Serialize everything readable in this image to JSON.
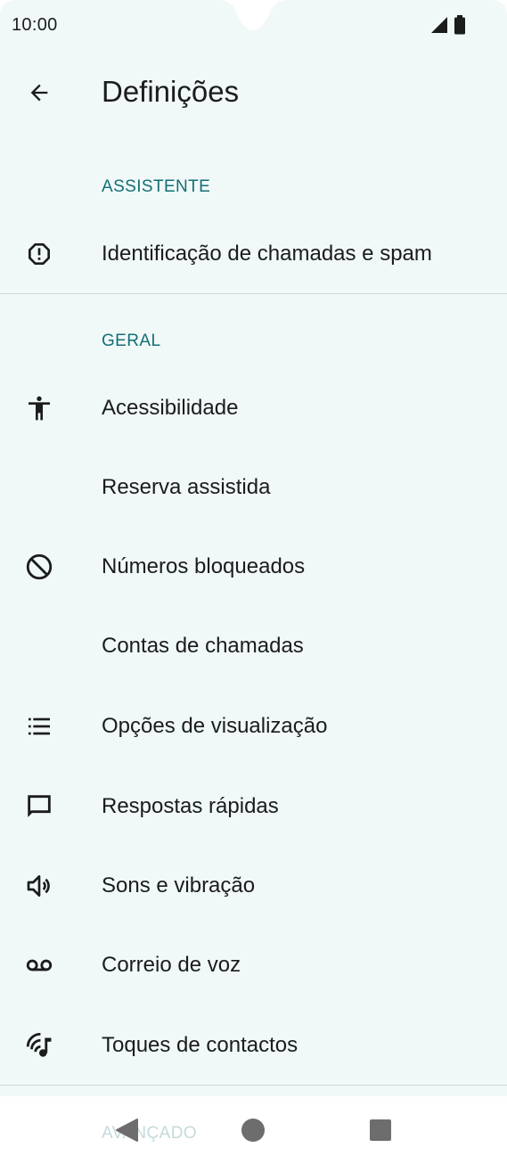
{
  "status_bar": {
    "time": "10:00",
    "icons": [
      "signal-icon",
      "battery-icon"
    ]
  },
  "app_bar": {
    "back_icon": "arrow-back-icon",
    "title": "Definições"
  },
  "sections": {
    "assistant": {
      "header": "ASSISTENTE",
      "items": [
        {
          "label": "Identificação de chamadas e spam",
          "icon": "alert-octagon-icon"
        }
      ]
    },
    "general": {
      "header": "GERAL",
      "items": [
        {
          "label": "Acessibilidade",
          "icon": "accessibility-icon"
        },
        {
          "label": "Reserva assistida",
          "icon": ""
        },
        {
          "label": "Números bloqueados",
          "icon": "block-icon"
        },
        {
          "label": "Contas de chamadas",
          "icon": ""
        },
        {
          "label": "Opções de visualização",
          "icon": "list-icon"
        },
        {
          "label": "Respostas rápidas",
          "icon": "message-icon"
        },
        {
          "label": "Sons e vibração",
          "icon": "volume-icon"
        },
        {
          "label": "Correio de voz",
          "icon": "voicemail-icon"
        },
        {
          "label": "Toques de contactos",
          "icon": "ringtone-icon"
        }
      ]
    },
    "advanced": {
      "header": "AVANÇADO"
    }
  },
  "nav_bar": {
    "back": "nav-back-icon",
    "home": "nav-home-icon",
    "recents": "nav-recents-icon"
  },
  "colors": {
    "background": "#f1f8f8",
    "accent": "#136f75",
    "text": "#1b1c1c"
  }
}
